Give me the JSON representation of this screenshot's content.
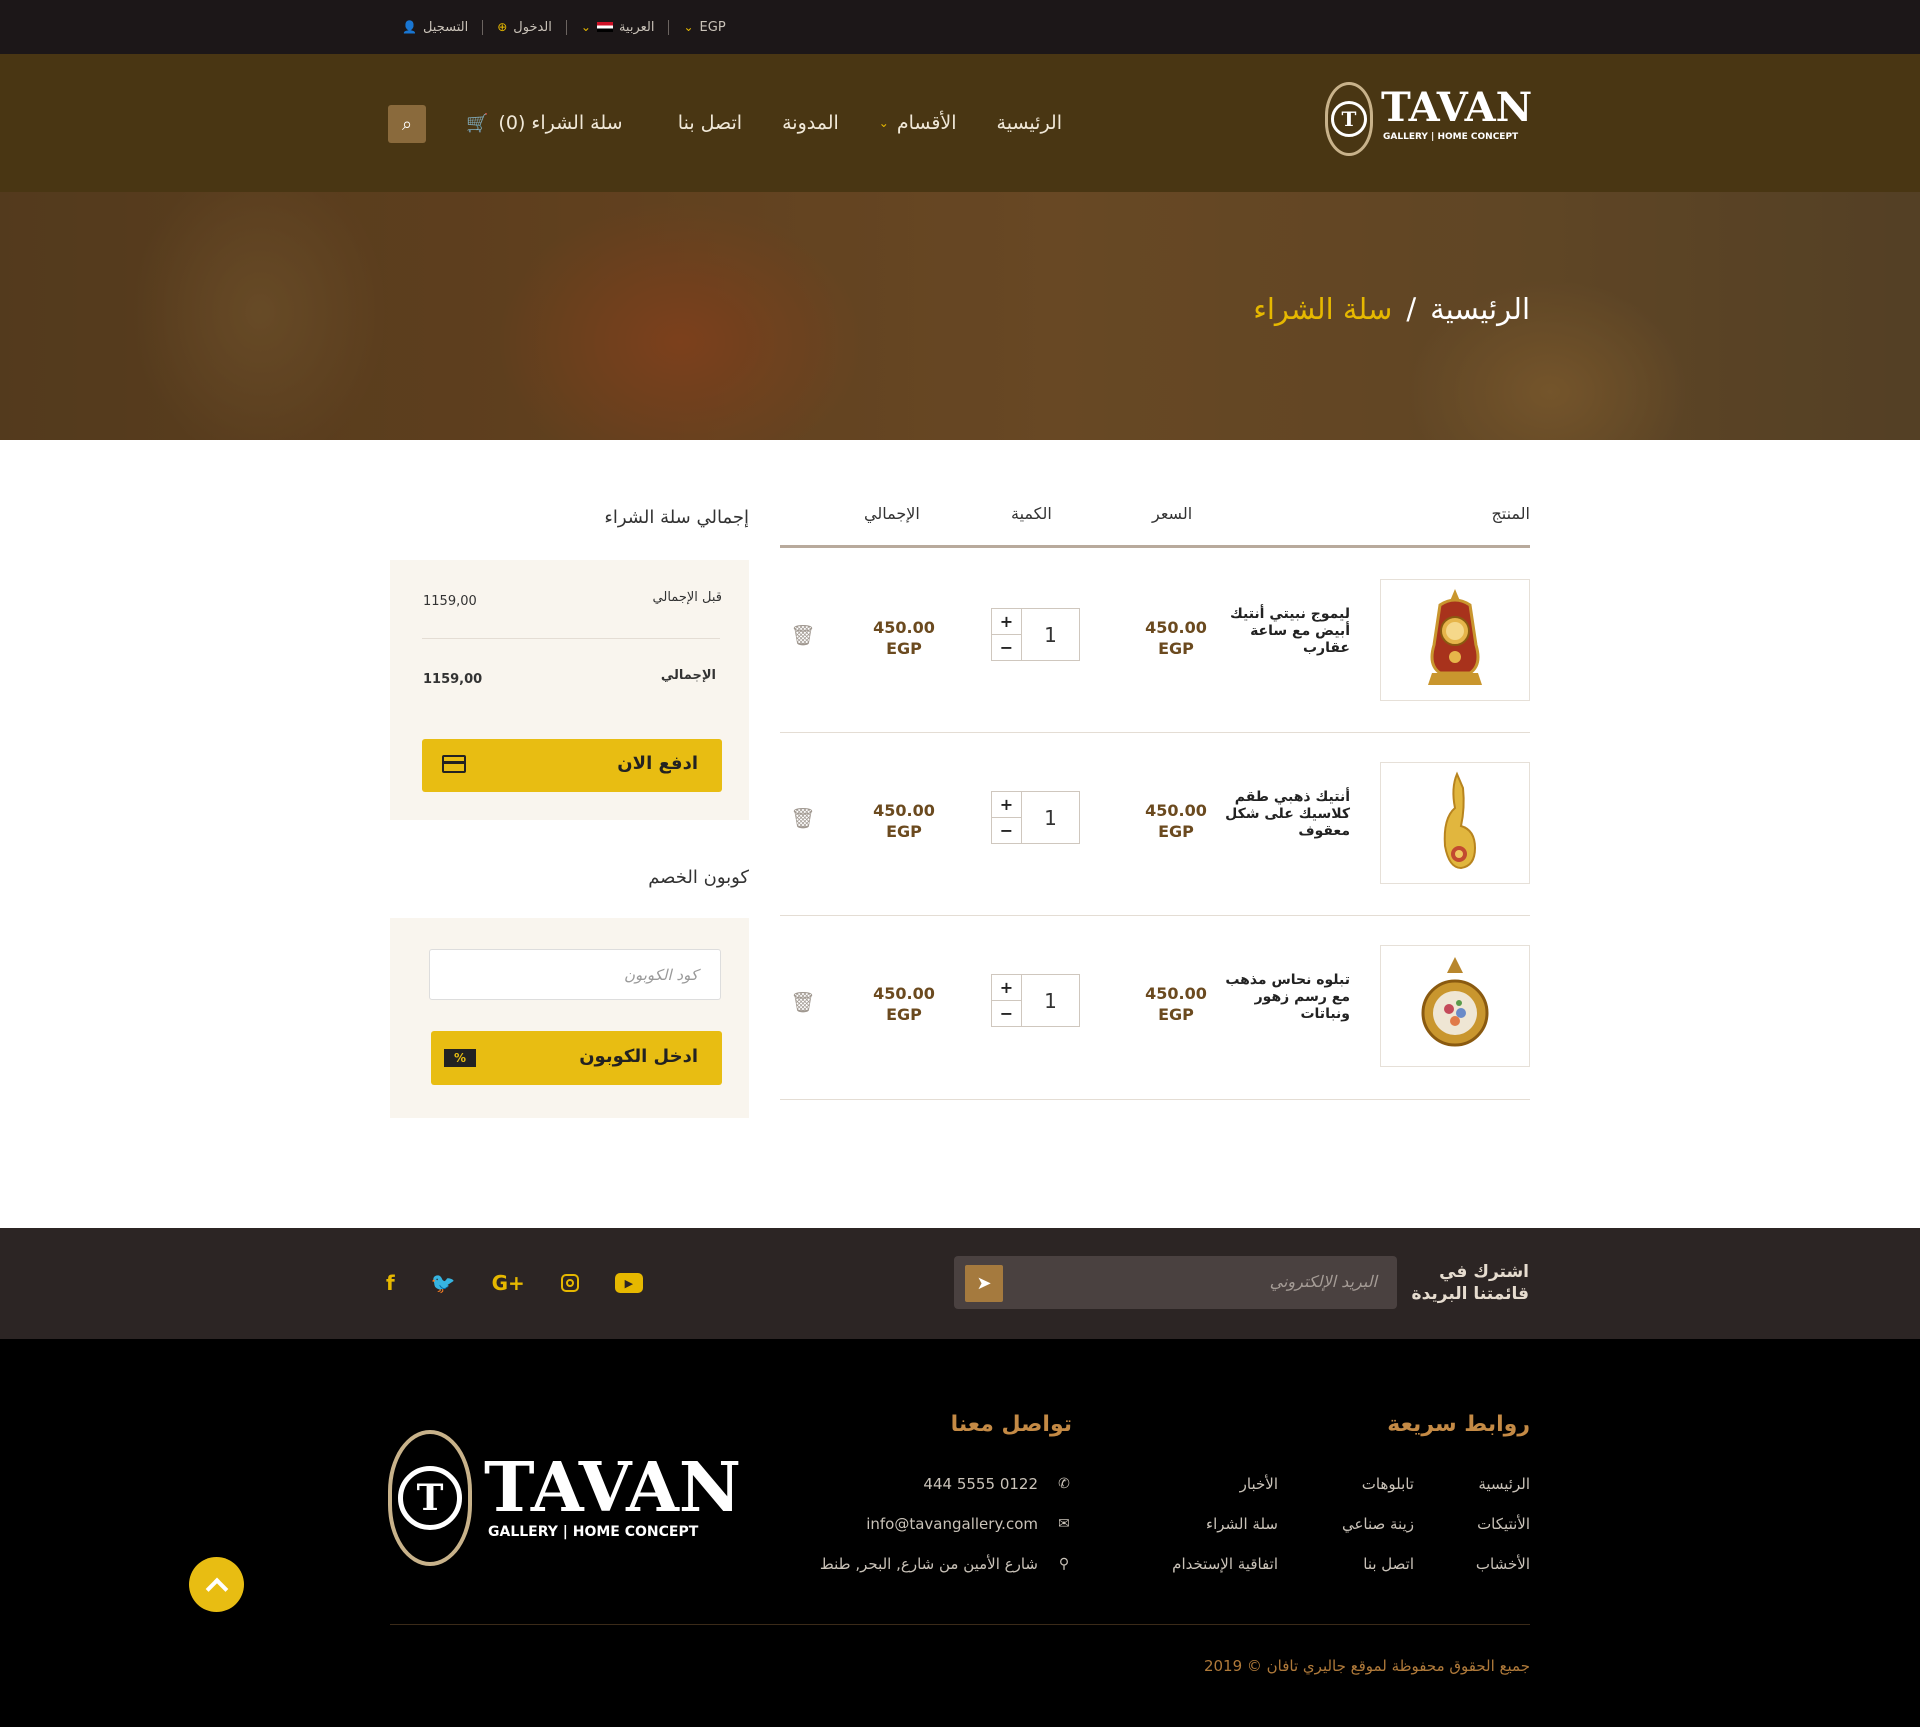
{
  "topbar": {
    "currency": "EGP",
    "language": "العربية",
    "login": "الدخول",
    "register": "التسجيل"
  },
  "header": {
    "logo_word": "TAVAN",
    "logo_sub": "GALLERY | HOME CONCEPT",
    "logo_letter": "T",
    "nav": {
      "home": "الرئيسية",
      "categories": "الأقسام",
      "blog": "المدونة",
      "contact": "اتصل بنا"
    },
    "cart_label": "سلة الشراء (0)"
  },
  "breadcrumb": {
    "home": "الرئيسية",
    "separator": "/",
    "current": "سلة الشراء"
  },
  "cart_table": {
    "headers": {
      "product": "المنتج",
      "price": "السعر",
      "quantity": "الكمية",
      "total": "الإجمالي"
    },
    "rows": [
      {
        "name": "ليموج نبيتي أنتيك أبيض مع ساعة عقارب",
        "price": "450.00",
        "currency": "EGP",
        "qty": "1",
        "total": "450.00",
        "total_currency": "EGP",
        "image": "clock-icon"
      },
      {
        "name": "أنتيك ذهبي طقم كلاسيك على شكل معقوف",
        "price": "450.00",
        "currency": "EGP",
        "qty": "1",
        "total": "450.00",
        "total_currency": "EGP",
        "image": "vase-icon"
      },
      {
        "name": "تبلوه نحاس مذهب مع رسم زهور ونباتات",
        "price": "450.00",
        "currency": "EGP",
        "qty": "1",
        "total": "450.00",
        "total_currency": "EGP",
        "image": "plaque-icon"
      }
    ],
    "plus": "+",
    "minus": "−"
  },
  "summary": {
    "title": "إجمالي سلة الشراء",
    "subtotal_label": "قبل الإجمالي",
    "subtotal_value": "1159,00",
    "total_label": "الإجمالي",
    "total_value": "1159,00",
    "pay_button": "ادفع الان"
  },
  "coupon": {
    "title": "كوبون الخصم",
    "placeholder": "كود الكوبون",
    "button": "ادخل الكوبون",
    "button_icon": "%"
  },
  "newsletter": {
    "title": "اشترك في قائمتنا البريدة",
    "placeholder": "البريد الإلكتروني"
  },
  "footer": {
    "quick_links_title": "روابط سريعة",
    "quick_links": {
      "col1": [
        "الرئيسية",
        "الأنتيكات",
        "الأخشاب"
      ],
      "col2": [
        "تابلوهات",
        "زينة صناعي",
        "اتصل بنا"
      ],
      "col3": [
        "الأخبار",
        "سلة الشراء",
        "اتفاقية الإستخدام"
      ]
    },
    "contact_title": "تواصل معنا",
    "phone": "0122 5555 444",
    "email": "info@tavangallery.com",
    "address": "شارع الأمين من شارع, البحر, طنط",
    "copyright": "جميع الحقوق محفوظة لموقع جاليري تافان © 2019"
  },
  "colors": {
    "accent": "#e8bd12",
    "header_bg": "#493613",
    "price": "#6b4a1f",
    "footer_title": "#c48a45"
  }
}
